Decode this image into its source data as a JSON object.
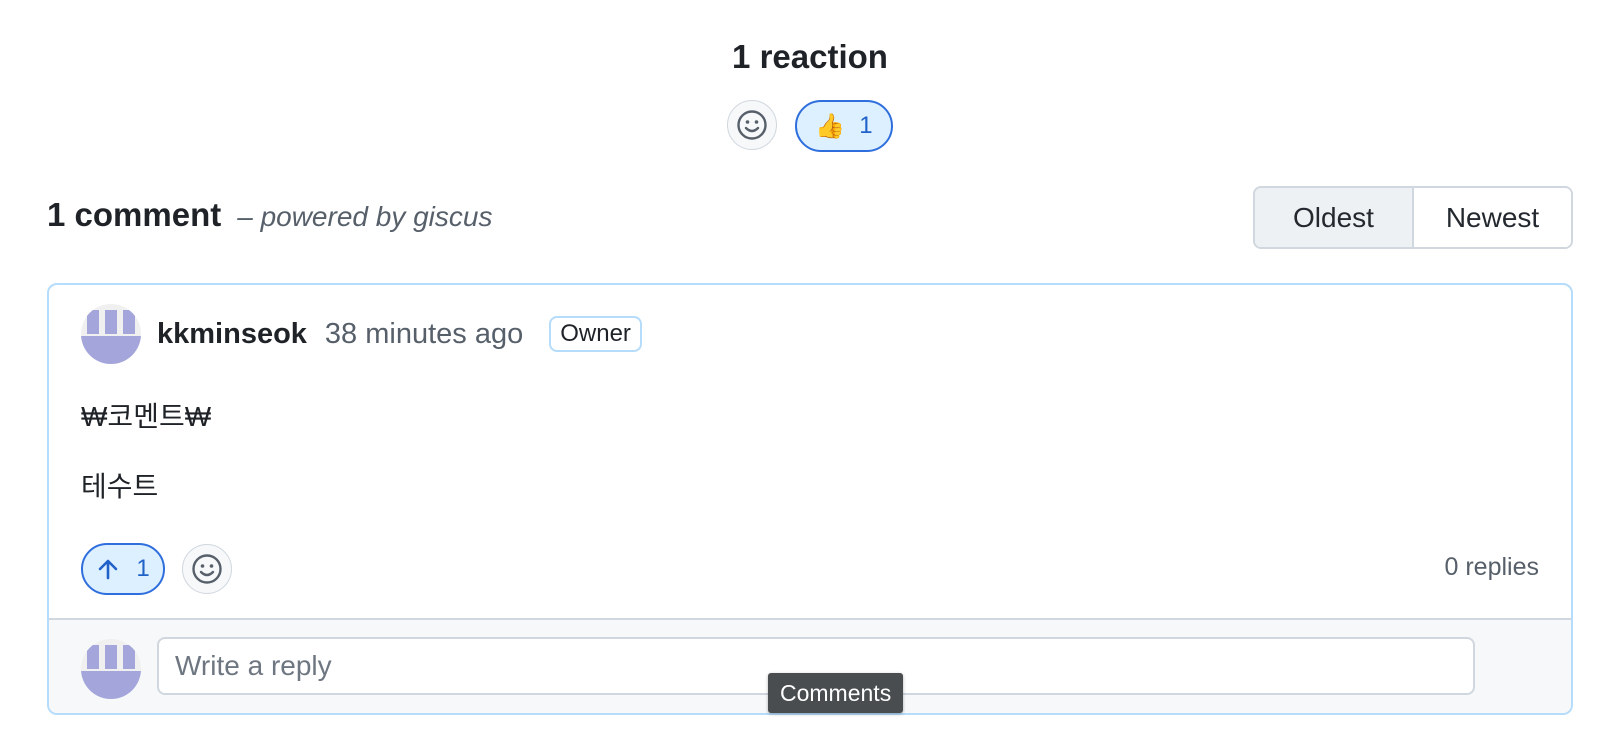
{
  "reactions": {
    "title": "1 reaction",
    "items": [
      {
        "emoji_name": "thumbs-up-icon",
        "emoji": "👍",
        "count": "1"
      }
    ]
  },
  "comments": {
    "count_label": "1 comment",
    "powered_by": "– powered by giscus",
    "sort": {
      "oldest": "Oldest",
      "newest": "Newest",
      "selected": "Oldest"
    }
  },
  "comment": {
    "author": "kkminseok",
    "time": "38 minutes ago",
    "badge": "Owner",
    "body": [
      "₩코멘트₩",
      "테수트"
    ],
    "upvotes": "1",
    "replies": "0 replies"
  },
  "reply": {
    "placeholder": "Write a reply"
  },
  "tooltip": {
    "text": "Comments"
  },
  "colors": {
    "accent": "#2f6fdd",
    "accent_bg": "#ddf0ff",
    "comment_border": "#b6dcfb",
    "avatar": "#a4a6db"
  }
}
